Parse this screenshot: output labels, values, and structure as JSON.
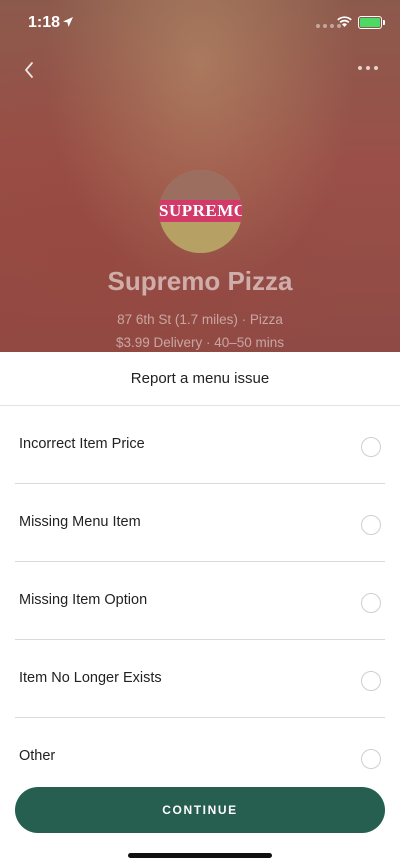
{
  "status_bar": {
    "time": "1:18"
  },
  "restaurant": {
    "logo_text": "SUPREMO",
    "name": "Supremo Pizza",
    "address_line": "87 6th St (1.7 miles) · Pizza",
    "delivery_line": "$3.99 Delivery · 40–50 mins"
  },
  "sheet": {
    "title": "Report a menu issue",
    "options": [
      {
        "label": "Incorrect Item Price",
        "selected": false
      },
      {
        "label": "Missing Menu Item",
        "selected": false
      },
      {
        "label": "Missing Item Option",
        "selected": false
      },
      {
        "label": "Item No Longer Exists",
        "selected": false
      },
      {
        "label": "Other",
        "selected": false
      }
    ],
    "continue_label": "CONTINUE"
  },
  "colors": {
    "primary_button": "#265e4f",
    "battery": "#4cd964"
  },
  "icons": [
    "location-arrow-icon",
    "wifi-icon",
    "battery-icon",
    "back-chevron-icon",
    "more-icon"
  ]
}
